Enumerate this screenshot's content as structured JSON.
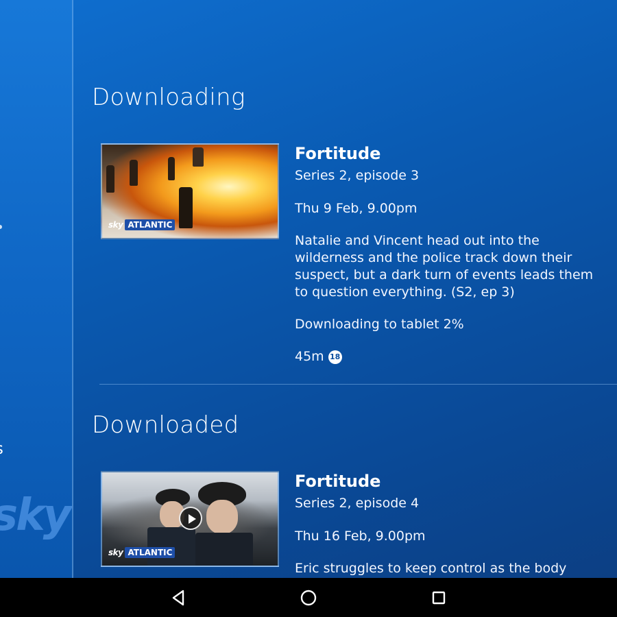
{
  "sidebar": {
    "item_label": "ls",
    "logo": "sky"
  },
  "sections": [
    {
      "title": "Downloading",
      "item": {
        "title": "Fortitude",
        "subtitle": "Series 2, episode 3",
        "airdate": "Thu 9 Feb, 9.00pm",
        "description": "Natalie and Vincent head out into the wilderness and the police track down their suspect, but a dark turn of events leads them to question everything. (S2, ep 3)",
        "status": "Downloading to tablet 2%",
        "download_progress_percent": 2,
        "duration": "45m",
        "rating": "18",
        "channel_brand": "sky",
        "channel_name": "ATLANTIC"
      }
    },
    {
      "title": "Downloaded",
      "item": {
        "title": "Fortitude",
        "subtitle": "Series 2, episode 4",
        "airdate": "Thu 16 Feb, 9.00pm",
        "description": "Eric struggles to keep control as the body",
        "channel_brand": "sky",
        "channel_name": "ATLANTIC"
      }
    }
  ],
  "navbar": {
    "icons": [
      "back-icon",
      "home-icon",
      "recents-icon"
    ]
  },
  "colors": {
    "background": "#0a5bb3",
    "rating_badge": "#ffffff",
    "navbar": "#000000"
  }
}
